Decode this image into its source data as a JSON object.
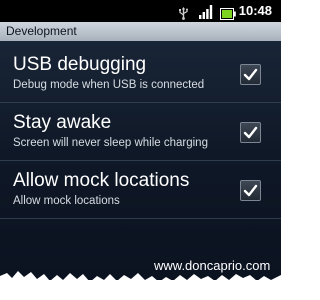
{
  "status_bar": {
    "time": "10:48",
    "icons": [
      "usb-icon",
      "signal-strength-icon",
      "battery-icon"
    ]
  },
  "header": {
    "title": "Development"
  },
  "settings": [
    {
      "title": "USB debugging",
      "summary": "Debug mode when USB is connected",
      "checked": true
    },
    {
      "title": "Stay awake",
      "summary": "Screen will never sleep while charging",
      "checked": true
    },
    {
      "title": "Allow mock locations",
      "summary": "Allow mock locations",
      "checked": true
    }
  ],
  "watermark": "www.doncaprio.com",
  "colors": {
    "status_bar": "#000000",
    "title_bar": "#b9c1ca",
    "background": "#131f30",
    "battery": "#7ed321"
  }
}
